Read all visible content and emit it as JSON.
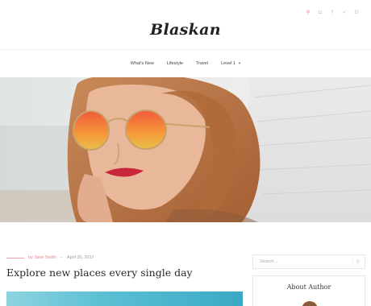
{
  "header": {
    "logo": "Blaskan",
    "social": [
      {
        "icon": "search-icon",
        "glyph": "⚲"
      },
      {
        "icon": "instagram-icon",
        "glyph": "◘"
      },
      {
        "icon": "facebook-icon",
        "glyph": "f"
      },
      {
        "icon": "twitter-icon",
        "glyph": "✓"
      },
      {
        "icon": "google-plus-icon",
        "glyph": "G"
      }
    ]
  },
  "nav": {
    "items": [
      "What's New",
      "Lifestyle",
      "Travel",
      "Level 1"
    ],
    "dropdown_icon": "chevron-down-icon"
  },
  "post": {
    "author": "by Jane Smith",
    "separator": "–",
    "date": "April 20, 2017",
    "title": "Explore new places every single day"
  },
  "sidebar": {
    "search_placeholder": "Search...",
    "widget_title": "About Author"
  },
  "colors": {
    "accent": "#e0707a",
    "border": "#e6e6e6"
  }
}
